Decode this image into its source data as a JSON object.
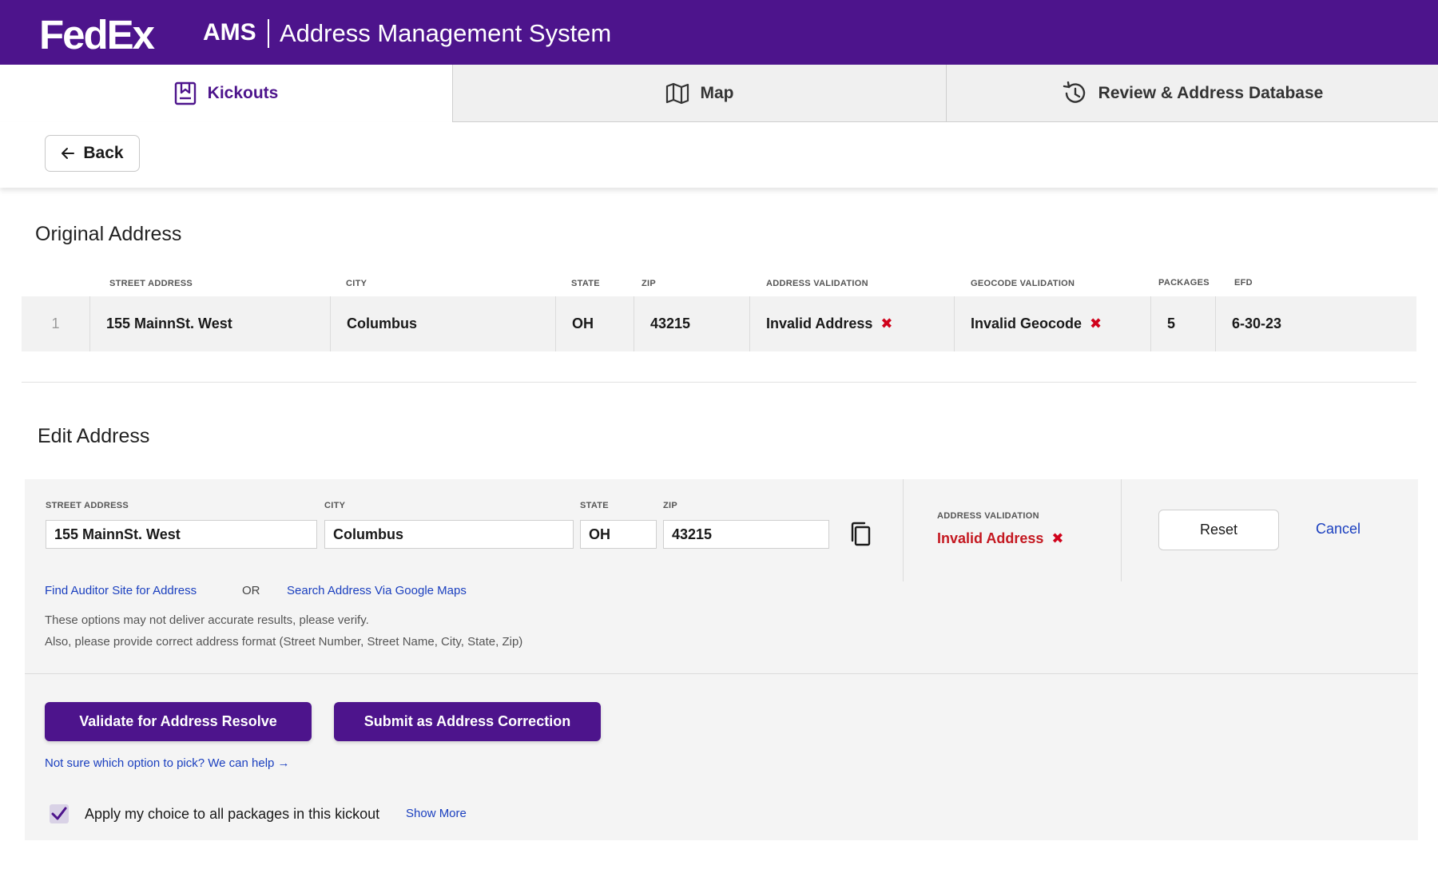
{
  "header": {
    "logo": "FedEx",
    "app_abbr": "AMS",
    "app_name": "Address Management System"
  },
  "tabs": [
    {
      "label": "Kickouts",
      "icon": "bookmark-list-icon",
      "active": true
    },
    {
      "label": "Map",
      "icon": "map-icon",
      "active": false
    },
    {
      "label": "Review & Address Database",
      "icon": "history-icon",
      "active": false
    }
  ],
  "toolbar": {
    "back_label": "Back"
  },
  "original": {
    "title": "Original Address",
    "headers": {
      "street": "STREET ADDRESS",
      "city": "CITY",
      "state": "STATE",
      "zip": "ZIP",
      "address_validation": "ADDRESS VALIDATION",
      "geocode_validation": "GEOCODE VALIDATION",
      "packages": "PACKAGES",
      "efd": "EFD"
    },
    "row": {
      "index": "1",
      "street": "155 MainnSt. West",
      "city": "Columbus",
      "state": "OH",
      "zip": "43215",
      "address_validation": "Invalid Address",
      "geocode_validation": "Invalid Geocode",
      "packages": "5",
      "efd": "6-30-23"
    }
  },
  "edit": {
    "title": "Edit Address",
    "labels": {
      "street": "STREET ADDRESS",
      "city": "CITY",
      "state": "STATE",
      "zip": "ZIP",
      "address_validation": "ADDRESS VALIDATION"
    },
    "values": {
      "street": "155 MainnSt. West",
      "city": "Columbus",
      "state": "OH",
      "zip": "43215"
    },
    "validation_status": "Invalid Address",
    "reset_label": "Reset",
    "cancel_label": "Cancel",
    "auditor_link": "Find Auditor Site for Address",
    "or_text": "OR",
    "maps_link": "Search Address Via Google Maps",
    "note_1": "These options may not deliver accurate results, please verify.",
    "note_2": "Also, please provide correct address format (Street Number, Street Name, City, State, Zip)",
    "validate_button": "Validate for Address Resolve",
    "submit_button": "Submit as Address Correction",
    "help_link": "Not sure which option to pick? We can help →",
    "apply_label": "Apply my choice to all packages in this kickout",
    "apply_checked": true,
    "show_more": "Show More"
  },
  "colors": {
    "brand_purple": "#4d148c",
    "error_red": "#c41820",
    "link_blue": "#1a3fbf"
  }
}
